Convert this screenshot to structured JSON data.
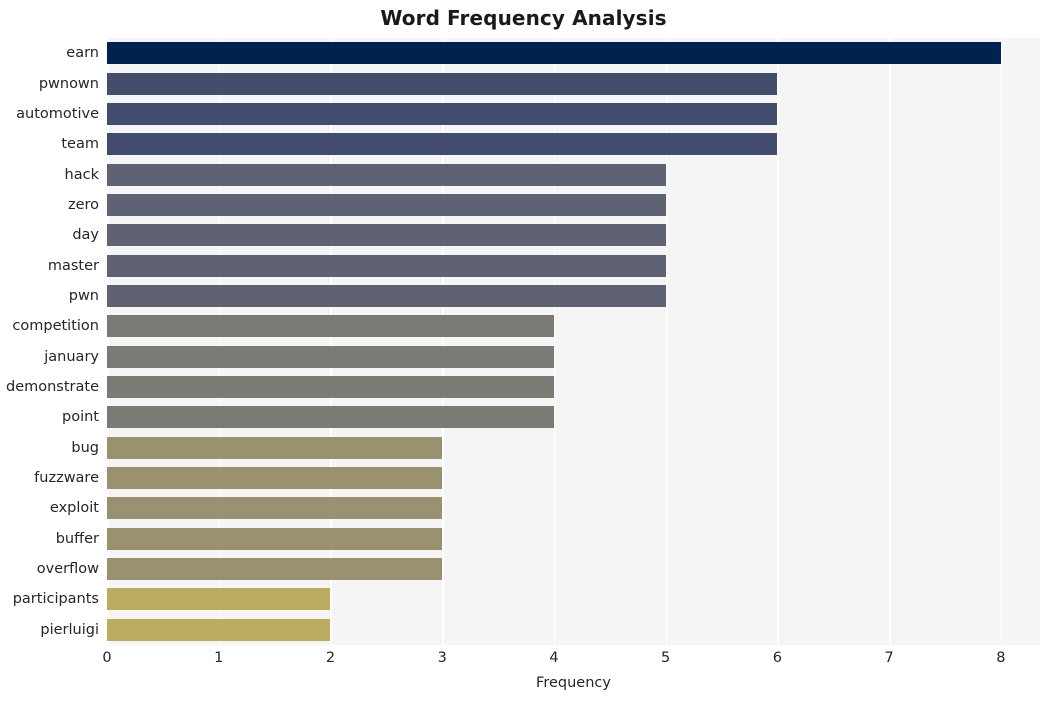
{
  "chart_data": {
    "type": "bar",
    "orientation": "horizontal",
    "title": "Word Frequency Analysis",
    "xlabel": "Frequency",
    "ylabel": "",
    "xlim": [
      0,
      8.35
    ],
    "xticks": [
      0,
      1,
      2,
      3,
      4,
      5,
      6,
      7,
      8
    ],
    "xtick_labels": [
      "0",
      "1",
      "2",
      "3",
      "4",
      "5",
      "6",
      "7",
      "8"
    ],
    "grid": true,
    "grid_axis": "x",
    "legend": false,
    "categories": [
      "earn",
      "pwnown",
      "automotive",
      "team",
      "hack",
      "zero",
      "day",
      "master",
      "pwn",
      "competition",
      "january",
      "demonstrate",
      "point",
      "bug",
      "fuzzware",
      "exploit",
      "buffer",
      "overflow",
      "participants",
      "pierluigi"
    ],
    "values": [
      8,
      6,
      6,
      6,
      5,
      5,
      5,
      5,
      5,
      4,
      4,
      4,
      4,
      3,
      3,
      3,
      3,
      3,
      2,
      2
    ],
    "bar_colors": [
      "#00224e",
      "#434e6f",
      "#434e6f",
      "#434e6f",
      "#5e6272",
      "#5e6272",
      "#5e6272",
      "#5e6272",
      "#5e6272",
      "#7b7a75",
      "#7b7a75",
      "#7b7a75",
      "#7b7a75",
      "#9a9171",
      "#9a9171",
      "#9a9171",
      "#9a9171",
      "#9a9171",
      "#bcac62",
      "#bcac62"
    ],
    "plot_background": "#f5f5f6",
    "grid_color": "#ffffff",
    "figure_background": "#ffffff"
  }
}
